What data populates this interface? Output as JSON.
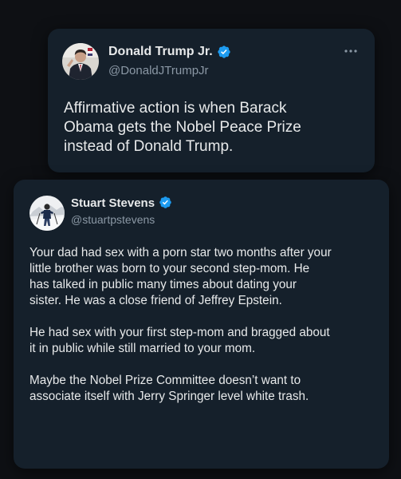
{
  "original_tweet": {
    "display_name": "Donald Trump Jr.",
    "handle": "@DonaldJTrumpJr",
    "verified_icon": "verified-badge-icon",
    "more_icon": "more-options-icon",
    "text": "Affirmative action is when Barack\nObama gets the Nobel Peace Prize\ninstead of Donald Trump."
  },
  "quote_tweet": {
    "display_name": "Stuart Stevens",
    "handle": "@stuartpstevens",
    "verified_icon": "verified-badge-icon",
    "paragraphs": [
      "Your dad had sex with a porn star two months after your\nlittle brother was born to your second step-mom. He\nhas talked in public many times about dating your\nsister. He was a close friend of Jeffrey Epstein.",
      "He had sex with your first step-mom and bragged about\nit in public while still married to your mom.",
      "Maybe the Nobel Prize Committee doesn’t want to\nassociate itself with Jerry Springer level white trash."
    ]
  },
  "colors": {
    "page_background": "#0e1014",
    "card_background": "#15202b",
    "text_primary": "#e7e9ea",
    "text_secondary": "#8b98a5",
    "verified_blue": "#1d9bf0"
  }
}
